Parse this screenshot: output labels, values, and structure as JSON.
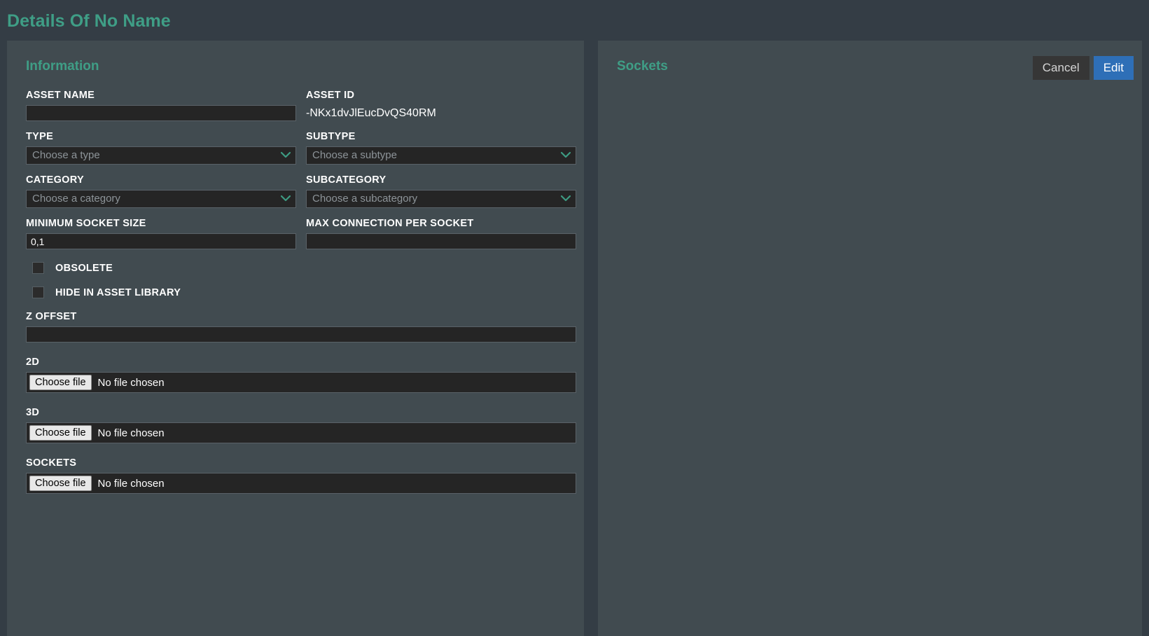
{
  "page": {
    "title": "Details Of No Name",
    "accent_color": "#3f9e86",
    "background_color": "#343d45",
    "panel_color": "#414b50",
    "input_color": "#252525",
    "edit_button_color": "#2e6fb7",
    "cancel_button_color": "#363636"
  },
  "information_panel": {
    "title": "Information",
    "fields": {
      "asset_name": {
        "label": "Asset Name",
        "value": "",
        "placeholder": ""
      },
      "asset_id": {
        "label": "Asset ID",
        "value": "-NKx1dvJlEucDvQS40RM"
      },
      "type": {
        "label": "Type",
        "value": "Choose a type",
        "chevron_icon": "chevron-down-icon"
      },
      "subtype": {
        "label": "Subtype",
        "value": "Choose a subtype",
        "chevron_icon": "chevron-down-icon"
      },
      "category": {
        "label": "Category",
        "value": "Choose a category",
        "chevron_icon": "chevron-down-icon"
      },
      "subcategory": {
        "label": "Subcategory",
        "value": "Choose a subcategory",
        "chevron_icon": "chevron-down-icon"
      },
      "minimum_socket_size": {
        "label": "Minimum Socket Size",
        "value": "0,1",
        "placeholder": ""
      },
      "max_connection_per_socket": {
        "label": "Max Connection Per Socket",
        "value": "",
        "placeholder": ""
      },
      "obsolete": {
        "label": "Obsolete",
        "checked": false
      },
      "hide_in_asset_library": {
        "label": "Hide In Asset Library",
        "checked": false
      },
      "z_offset": {
        "label": "Z Offset",
        "value": "",
        "placeholder": ""
      },
      "file_2d": {
        "label": "2D",
        "button_label": "Choose file",
        "file_status": "No file chosen"
      },
      "file_3d": {
        "label": "3D",
        "button_label": "Choose file",
        "file_status": "No file chosen"
      },
      "file_sockets": {
        "label": "Sockets",
        "button_label": "Choose file",
        "file_status": "No file chosen"
      }
    }
  },
  "sockets_panel": {
    "title": "Sockets",
    "cancel_label": "Cancel",
    "edit_label": "Edit",
    "items": []
  }
}
